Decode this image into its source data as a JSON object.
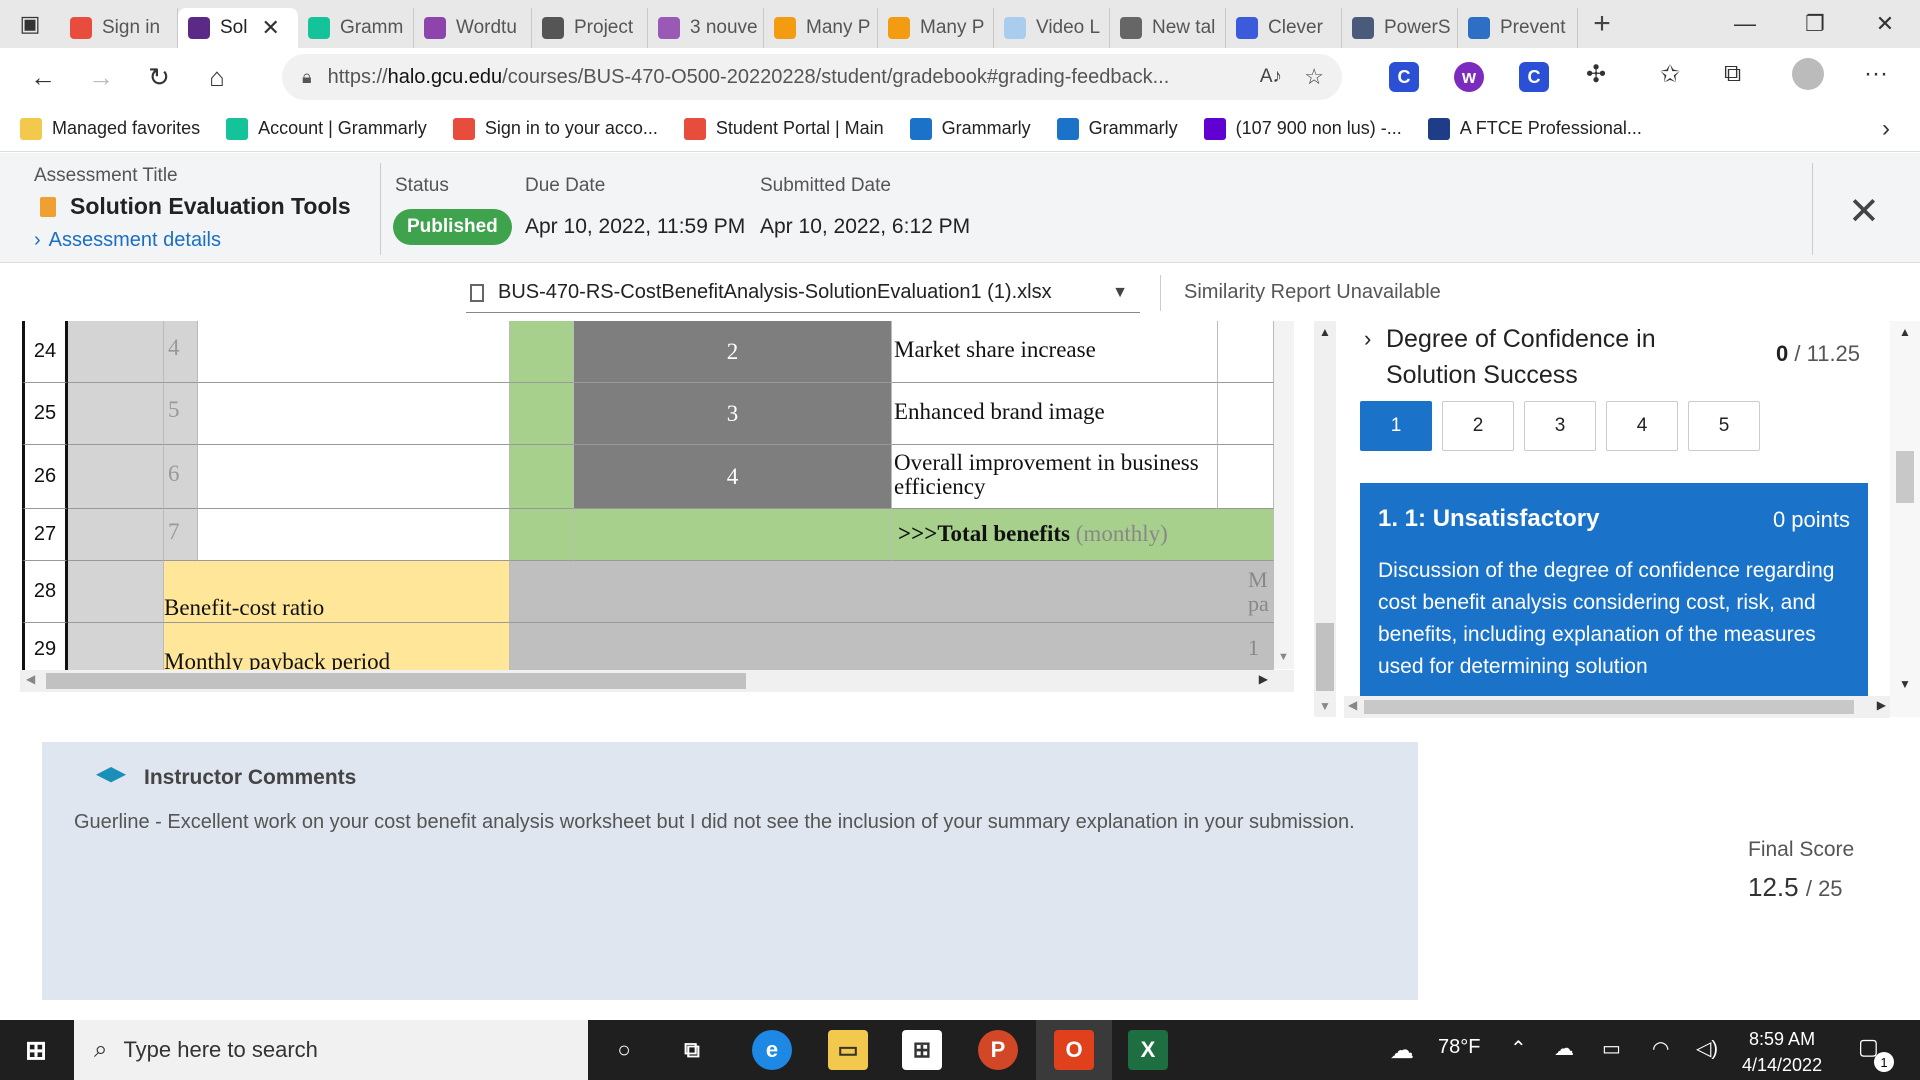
{
  "browser": {
    "tabs": [
      {
        "label": "Sign in",
        "color": "#e74c3c",
        "icon": "windows-icon"
      },
      {
        "label": "Sol",
        "color": "#5b2a86",
        "icon": "halo-icon",
        "active": true
      },
      {
        "label": "Gramm",
        "color": "#15c39a",
        "icon": "grammarly-icon"
      },
      {
        "label": "Wordtu",
        "color": "#8e44ad",
        "icon": "wordtune-icon"
      },
      {
        "label": "Project",
        "color": "#555555",
        "icon": "project-icon"
      },
      {
        "label": "3 nouve",
        "color": "#9b59b6",
        "icon": "mail-icon"
      },
      {
        "label": "Many P",
        "color": "#f39c12",
        "icon": "c-icon"
      },
      {
        "label": "Many P",
        "color": "#f39c12",
        "icon": "c-icon"
      },
      {
        "label": "Video L",
        "color": "#aaccee",
        "icon": "video-icon"
      },
      {
        "label": "New tal",
        "color": "#666666",
        "icon": "newtab-icon"
      },
      {
        "label": "Clever",
        "color": "#3b5bdb",
        "icon": "clever-icon"
      },
      {
        "label": "PowerS",
        "color": "#4a5a7a",
        "icon": "powerschool-icon"
      },
      {
        "label": "Prevent",
        "color": "#2d6fc4",
        "icon": "prevent-icon"
      }
    ],
    "url_prefix": "https://",
    "url_host": "halo.gcu.edu",
    "url_path": "/courses/BUS-470-O500-20220228/student/gradebook#grading-feedback...",
    "favorites": [
      {
        "label": "Managed favorites",
        "icon": "folder-icon",
        "color": "#f2c94c"
      },
      {
        "label": "Account | Grammarly",
        "icon": "grammarly-icon",
        "color": "#15c39a"
      },
      {
        "label": "Sign in to your acco...",
        "icon": "windows-icon",
        "color": "#e74c3c"
      },
      {
        "label": "Student Portal | Main",
        "icon": "windows-icon",
        "color": "#e74c3c"
      },
      {
        "label": "Grammarly",
        "icon": "grammarly-icon",
        "color": "#1a73c8"
      },
      {
        "label": "Grammarly",
        "icon": "grammarly-icon",
        "color": "#1a73c8"
      },
      {
        "label": "(107 900 non lus) -...",
        "icon": "yahoo-icon",
        "color": "#6001d2"
      },
      {
        "label": "A FTCE Professional...",
        "icon": "p-icon",
        "color": "#1f3c88"
      }
    ]
  },
  "assessment": {
    "title_label": "Assessment Title",
    "title": "Solution Evaluation Tools",
    "details_link": "Assessment details",
    "status_label": "Status",
    "status": "Published",
    "due_label": "Due Date",
    "due": "Apr 10, 2022, 11:59 PM",
    "submitted_label": "Submitted Date",
    "submitted": "Apr 10, 2022, 6:12 PM"
  },
  "file": {
    "name": "BUS-470-RS-CostBenefitAnalysis-SolutionEvaluation1 (1).xlsx",
    "similarity": "Similarity Report Unavailable"
  },
  "sheet": {
    "rows": [
      {
        "num": "24",
        "idx": "4",
        "mid": "2",
        "label": "Market share increase"
      },
      {
        "num": "25",
        "idx": "5",
        "mid": "3",
        "label": "Enhanced brand image"
      },
      {
        "num": "26",
        "idx": "6",
        "mid": "4",
        "label": "Overall improvement in business efficiency"
      },
      {
        "num": "27",
        "idx": "7",
        "mid": "",
        "label": ">>>Total benefits",
        "label_suffix": "(monthly)"
      },
      {
        "num": "28",
        "idx": "",
        "label": "Benefit-cost ratio",
        "right_clip": "M",
        "right_clip2": "pa"
      },
      {
        "num": "29",
        "idx": "",
        "label": "Monthly payback period",
        "right_clip": "1"
      }
    ]
  },
  "rubric": {
    "criterion": "Degree of Confidence in Solution Success",
    "score": "0",
    "max": "/ 11.25",
    "levels": [
      "1",
      "2",
      "3",
      "4",
      "5"
    ],
    "selected_level": "1",
    "desc_title": "1. 1: Unsatisfactory",
    "desc_points": "0 points",
    "desc_text": "Discussion of the degree of confidence regarding cost benefit analysis considering cost, risk, and benefits, including explanation of the measures used for determining solution"
  },
  "comments": {
    "heading": "Instructor Comments",
    "text": "Guerline - Excellent work on your cost benefit analysis worksheet but I did not see the inclusion of your summary explanation in your submission."
  },
  "final": {
    "label": "Final Score",
    "score": "12.5",
    "max": "/ 25"
  },
  "taskbar": {
    "search_placeholder": "Type here to search",
    "temp": "78°F",
    "time": "8:59 AM",
    "date": "4/14/2022",
    "notif_count": "1"
  }
}
